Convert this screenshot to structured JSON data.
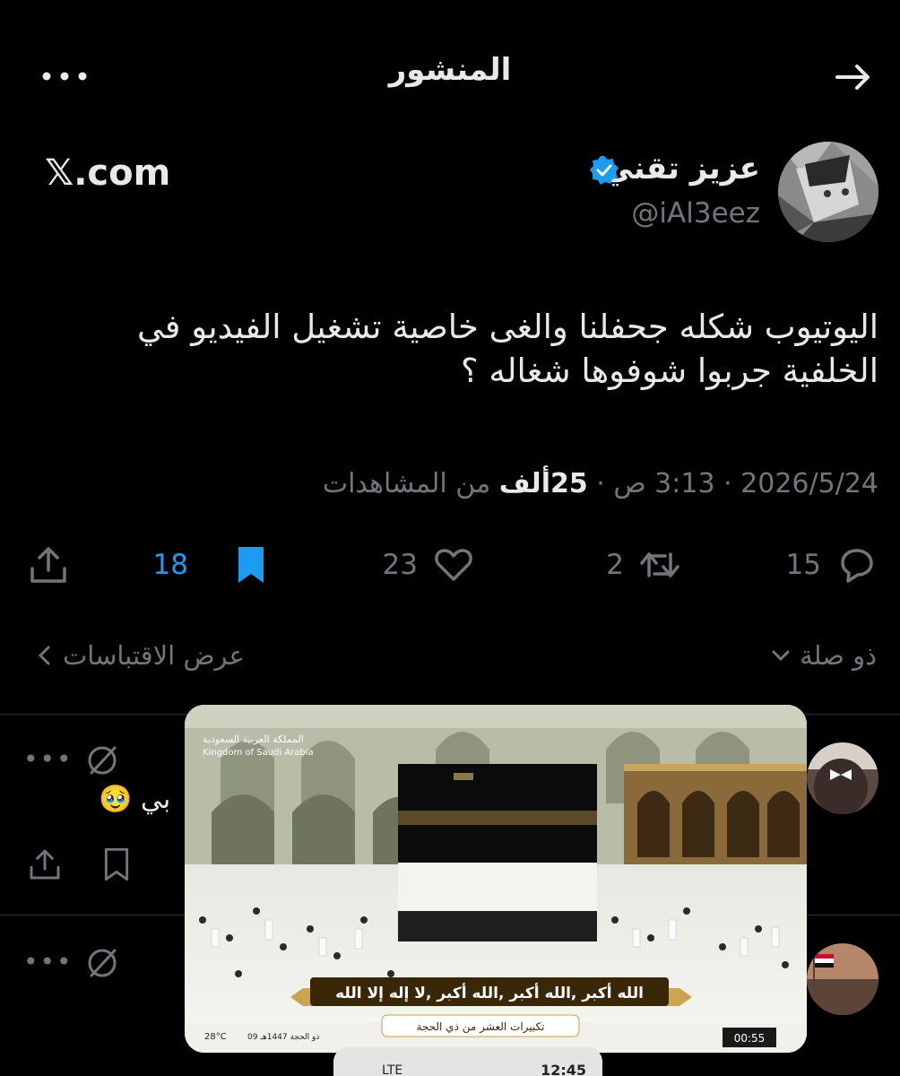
{
  "header": {
    "title": "المنشور"
  },
  "author": {
    "name": "عزيز تقني",
    "handle": "@iAl3eez",
    "verified": true,
    "source": "𝕏.com"
  },
  "tweet": {
    "text_line1": "اليوتيوب شكله جحفلنا والغى خاصية تشغيل الفيديو في",
    "text_line2": "الخلفية جربوا شوفوها شغاله ؟",
    "date": "2026/5/24",
    "time": "3:13 ص",
    "views_value": "25ألف",
    "views_label": "من المشاهدات"
  },
  "actions": {
    "replies": "15",
    "reposts": "2",
    "likes": "23",
    "bookmarks": "18",
    "bookmark_color": "#1d9bf0"
  },
  "relevance": {
    "label": "ذو صلة",
    "quotes_label": "عرض الاقتباسات"
  },
  "replies": [
    {
      "text_fragment": "بي 🥹"
    },
    {
      "text_fragment": ""
    }
  ],
  "video": {
    "country_ar": "المملكة العربية السعودية",
    "country_en": "Kingdom of Saudi Arabia",
    "banner": "الله أكبر ,الله أكبر ,الله أكبر ,لا إله إلا الله",
    "subtitle": "تكبيرات العشر من ذي الحجة",
    "temperature": "28°C",
    "hijri_date": "09 ذو الحجة 1447هـ",
    "elapsed": "00:55",
    "network": "LTE",
    "clock": "12:45"
  },
  "colors": {
    "background": "#000000",
    "text_primary": "#e7e9ea",
    "text_secondary": "#71767b",
    "accent": "#1d9bf0"
  }
}
